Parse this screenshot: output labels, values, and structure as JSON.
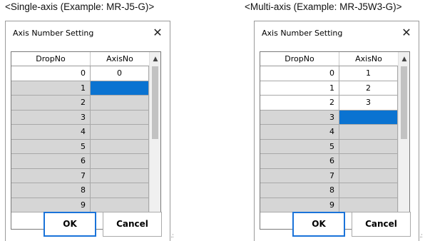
{
  "captions": {
    "left": "<Single-axis (Example: MR-J5-G)>",
    "right": "<Multi-axis (Example: MR-J5W3-G)>"
  },
  "dialog": {
    "title": "Axis Number Setting",
    "close_symbol": "✕",
    "columns": [
      "DropNo",
      "AxisNo"
    ],
    "ok_label": "OK",
    "cancel_label": "Cancel",
    "scroll_up": "▲",
    "scroll_down": "▼"
  },
  "single": {
    "rows": [
      {
        "drop": "0",
        "axis": "0",
        "style": "white"
      },
      {
        "drop": "1",
        "axis": "",
        "style": "gray",
        "selected": true
      },
      {
        "drop": "2",
        "axis": "",
        "style": "gray"
      },
      {
        "drop": "3",
        "axis": "",
        "style": "gray"
      },
      {
        "drop": "4",
        "axis": "",
        "style": "gray"
      },
      {
        "drop": "5",
        "axis": "",
        "style": "gray"
      },
      {
        "drop": "6",
        "axis": "",
        "style": "gray"
      },
      {
        "drop": "7",
        "axis": "",
        "style": "gray"
      },
      {
        "drop": "8",
        "axis": "",
        "style": "gray"
      },
      {
        "drop": "9",
        "axis": "",
        "style": "gray"
      }
    ]
  },
  "multi": {
    "rows": [
      {
        "drop": "0",
        "axis": "1",
        "style": "white"
      },
      {
        "drop": "1",
        "axis": "2",
        "style": "white"
      },
      {
        "drop": "2",
        "axis": "3",
        "style": "white"
      },
      {
        "drop": "3",
        "axis": "",
        "style": "gray",
        "selected": true
      },
      {
        "drop": "4",
        "axis": "",
        "style": "gray"
      },
      {
        "drop": "5",
        "axis": "",
        "style": "gray"
      },
      {
        "drop": "6",
        "axis": "",
        "style": "gray"
      },
      {
        "drop": "7",
        "axis": "",
        "style": "gray"
      },
      {
        "drop": "8",
        "axis": "",
        "style": "gray"
      },
      {
        "drop": "9",
        "axis": "",
        "style": "gray"
      }
    ]
  },
  "colors": {
    "selection": "#0a73d1",
    "gray_row": "#d6d6d6",
    "ok_border": "#1a73d9"
  }
}
